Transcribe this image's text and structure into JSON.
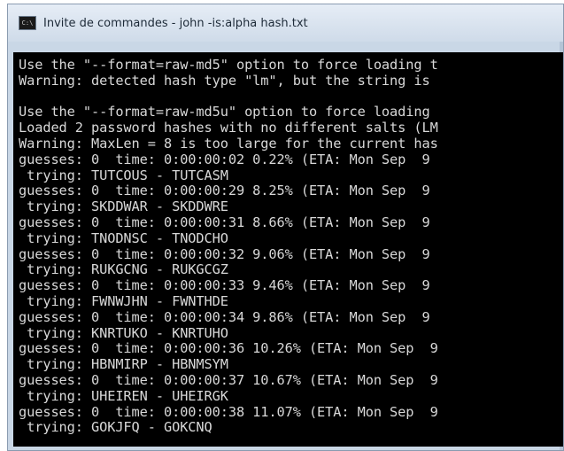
{
  "window": {
    "title": "Invite de commandes - john  -is:alpha hash.txt",
    "icon": "cmd-icon",
    "icon_text": "C:\\"
  },
  "console": {
    "lines": [
      "Use the \"--format=raw-md5\" option to force loading t",
      "Warning: detected hash type \"lm\", but the string is",
      "",
      "Use the \"--format=raw-md5u\" option to force loading",
      "Loaded 2 password hashes with no different salts (LM",
      "Warning: MaxLen = 8 is too large for the current has",
      "guesses: 0  time: 0:00:00:02 0.22% (ETA: Mon Sep  9",
      " trying: TUTCOUS - TUTCASM",
      "guesses: 0  time: 0:00:00:29 8.25% (ETA: Mon Sep  9",
      " trying: SKDDWAR - SKDDWRE",
      "guesses: 0  time: 0:00:00:31 8.66% (ETA: Mon Sep  9",
      " trying: TNODNSC - TNODCHO",
      "guesses: 0  time: 0:00:00:32 9.06% (ETA: Mon Sep  9",
      " trying: RUKGCNG - RUKGCGZ",
      "guesses: 0  time: 0:00:00:33 9.46% (ETA: Mon Sep  9",
      " trying: FWNWJHN - FWNTHDE",
      "guesses: 0  time: 0:00:00:34 9.86% (ETA: Mon Sep  9",
      " trying: KNRTUKO - KNRTUHO",
      "guesses: 0  time: 0:00:00:36 10.26% (ETA: Mon Sep  9",
      " trying: HBNMIRP - HBNMSYM",
      "guesses: 0  time: 0:00:00:37 10.67% (ETA: Mon Sep  9",
      " trying: UHEIREN - UHEIRGK",
      "guesses: 0  time: 0:00:00:38 11.07% (ETA: Mon Sep  9",
      " trying: GOKJFQ - GOKCNQ"
    ]
  },
  "colors": {
    "console_bg": "#000000",
    "console_text": "#d8d8d8",
    "titlebar": "#d6e2ef"
  }
}
